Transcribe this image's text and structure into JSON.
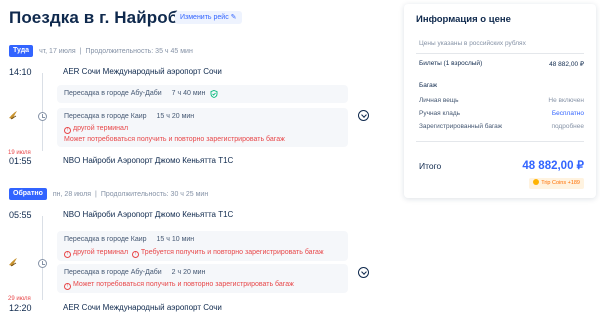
{
  "header": {
    "title": "Поездка в г. Найроби",
    "change_label": "Изменить рейс"
  },
  "outbound": {
    "badge": "Туда",
    "date": "чт, 17 июля",
    "duration": "Продолжительность: 35 ч 45 мин",
    "depart_time": "14:10",
    "depart_place": "AER Сочи Международный аэропорт Сочи",
    "layover1_city": "Пересадка в городе Абу-Даби",
    "layover1_dur": "7 ч 40 мин",
    "layover2_city": "Пересадка в городе Каир",
    "layover2_dur": "15 ч 20 мин",
    "warn1": "другой терминал",
    "warn2": "Может потребоваться получить и повторно зарегистрировать багаж",
    "arrive_date": "19 июля",
    "arrive_time": "01:55",
    "arrive_place": "NBO Найроби Аэропорт Джомо Кеньятта T1C"
  },
  "return": {
    "badge": "Обратно",
    "date": "пн, 28 июля",
    "duration": "Продолжительность: 30 ч 25 мин",
    "depart_time": "05:55",
    "depart_place": "NBO Найроби Аэропорт Джомо Кеньятта T1C",
    "layover1_city": "Пересадка в городе Каир",
    "layover1_dur": "15 ч 10 мин",
    "layover1_warn_a": "другой терминал",
    "layover1_warn_b": "Требуется получить и повторно зарегистрировать багаж",
    "layover2_city": "Пересадка в городе Абу-Даби",
    "layover2_dur": "2 ч 20 мин",
    "layover2_warn": "Может потребоваться получить и повторно зарегистрировать багаж",
    "arrive_date": "29 июля",
    "arrive_time": "12:20",
    "arrive_place": "AER Сочи Международный аэропорт Сочи"
  },
  "price": {
    "title": "Информация о цене",
    "note": "Цены указаны в российских рублях",
    "tickets_label": "Билеты (1 взрослый)",
    "tickets_value": "48 882,00 ₽",
    "baggage_header": "Багаж",
    "personal_label": "Личная вещь",
    "personal_value": "Не включен",
    "hand_label": "Ручная кладь",
    "hand_value": "Бесплатно",
    "checked_label": "Зарегистрированный багаж",
    "checked_value": "подробнее",
    "total_label": "Итого",
    "total_value": "48 882,00 ₽",
    "coins": "Trip Coins +189"
  },
  "colors": {
    "accent": "#3264ff",
    "text": "#0f294d",
    "warning": "#e8484a",
    "success": "#00b87a"
  }
}
